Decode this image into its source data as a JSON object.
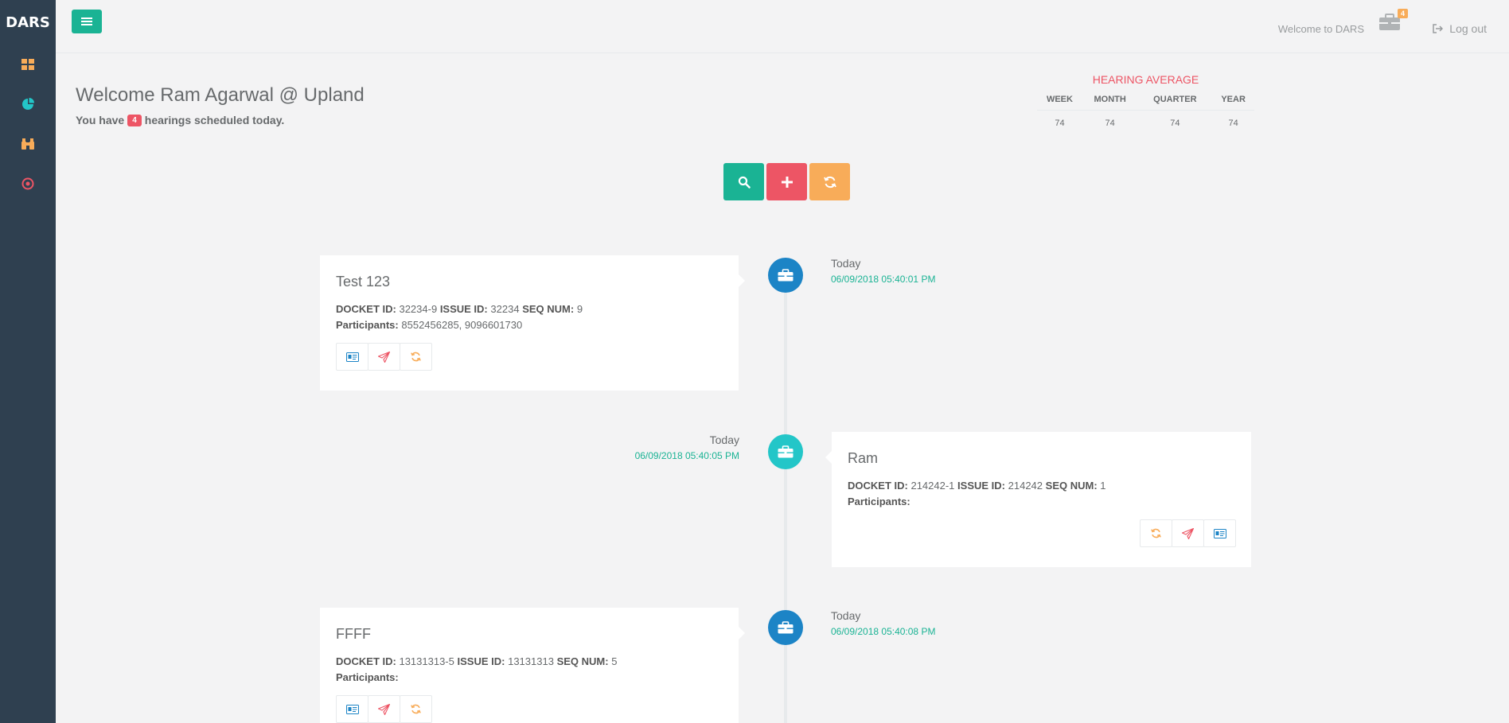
{
  "sidebar": {
    "brand": "DARS",
    "items": [
      {
        "icon": "dashboard-grid-icon",
        "color": "#f8ac59"
      },
      {
        "icon": "pie-chart-icon",
        "color": "#23c6c8"
      },
      {
        "icon": "binoculars-icon",
        "color": "#f8ac59"
      },
      {
        "icon": "target-icon",
        "color": "#ed5565"
      }
    ]
  },
  "topbar": {
    "welcome": "Welcome to DARS",
    "briefcase_count": "4",
    "logout_label": "Log out"
  },
  "welcome": {
    "title": "Welcome Ram Agarwal @ Upland",
    "sub_before": "You have",
    "count": "4",
    "sub_after": "hearings scheduled today."
  },
  "hearing_average": {
    "title": "HEARING AVERAGE",
    "headers": [
      "WEEK",
      "MONTH",
      "QUARTER",
      "YEAR"
    ],
    "values": [
      "74",
      "74",
      "74",
      "74"
    ]
  },
  "colors": {
    "primary": "#1ab394",
    "danger": "#ed5565",
    "warning": "#f8ac59",
    "info": "#23c6c8",
    "blue": "#1c84c6"
  },
  "timeline": [
    {
      "title": "Test 123",
      "docket_label": "DOCKET ID:",
      "docket": "32234-9",
      "issue_label": "ISSUE ID:",
      "issue": "32234",
      "seq_label": "SEQ NUM:",
      "seq": "9",
      "participants_label": "Participants:",
      "participants": "8552456285, 9096601730",
      "date_label": "Today",
      "date_time": "06/09/2018 05:40:01 PM"
    },
    {
      "title": "Ram",
      "docket_label": "DOCKET ID:",
      "docket": "214242-1",
      "issue_label": "ISSUE ID:",
      "issue": "214242",
      "seq_label": "SEQ NUM:",
      "seq": "1",
      "participants_label": "Participants:",
      "participants": "",
      "date_label": "Today",
      "date_time": "06/09/2018 05:40:05 PM"
    },
    {
      "title": "FFFF",
      "docket_label": "DOCKET ID:",
      "docket": "13131313-5",
      "issue_label": "ISSUE ID:",
      "issue": "13131313",
      "seq_label": "SEQ NUM:",
      "seq": "5",
      "participants_label": "Participants:",
      "participants": "",
      "date_label": "Today",
      "date_time": "06/09/2018 05:40:08 PM"
    }
  ]
}
